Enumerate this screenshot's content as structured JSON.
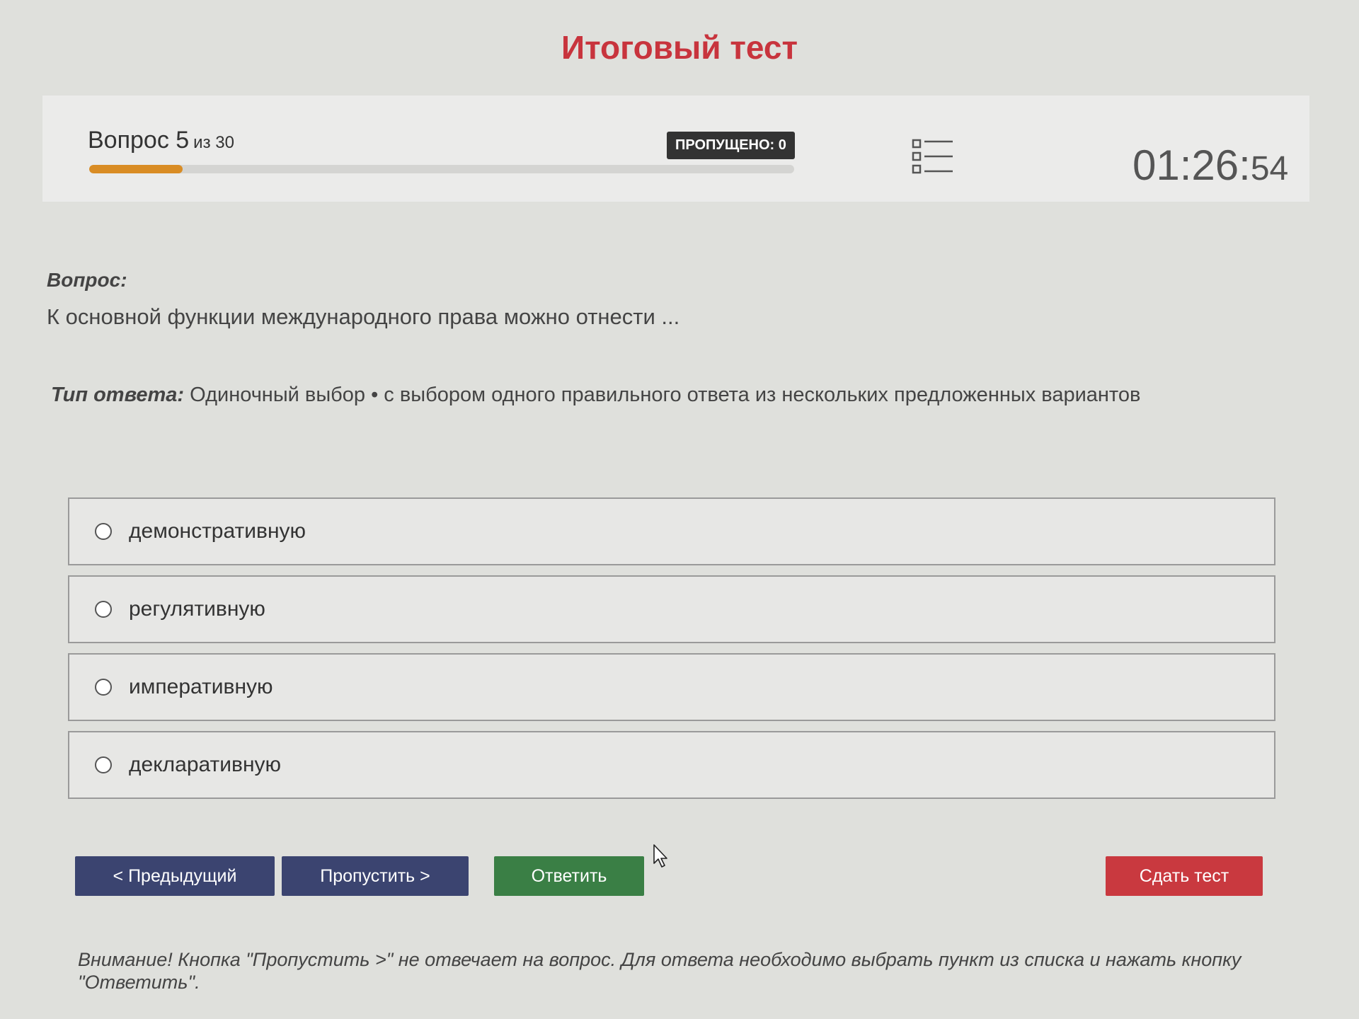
{
  "title": "Итоговый тест",
  "colors": {
    "title": "#c8343d",
    "progress_fill": "#d98c24",
    "primary_button": "#3b4470",
    "answer_button": "#3a7f45",
    "submit_button": "#c9393f"
  },
  "status": {
    "question_word": "Вопрос 5",
    "question_total": "из 30",
    "progress_fraction": 0.133,
    "skipped_label": "ПРОПУЩЕНО: 0",
    "question_list_icon": "list-icon",
    "timer_main": "01:26:",
    "timer_seconds": "54"
  },
  "question": {
    "label": "Вопрос:",
    "text": "К основной функции международного права можно отнести ..."
  },
  "answer_type": {
    "label": "Тип ответа:",
    "value": "Одиночный выбор • с выбором одного правильного ответа из нескольких предложенных вариантов"
  },
  "options": [
    {
      "label": "демонстративную"
    },
    {
      "label": "регулятивную"
    },
    {
      "label": "императивную"
    },
    {
      "label": "декларативную"
    }
  ],
  "buttons": {
    "prev": "< Предыдущий",
    "skip": "Пропустить >",
    "answer": "Ответить",
    "submit": "Сдать тест"
  },
  "warning": "Внимание! Кнопка \"Пропустить >\" не отвечает на вопрос. Для ответа необходимо выбрать пункт из списка и нажать кнопку \"Ответить\"."
}
